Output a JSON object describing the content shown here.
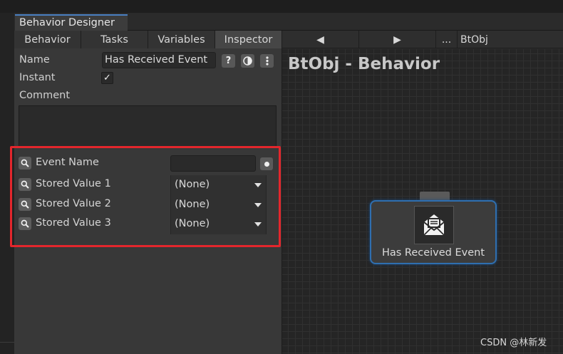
{
  "window": {
    "title": "Behavior Designer"
  },
  "tabs": [
    {
      "label": "Behavior"
    },
    {
      "label": "Tasks"
    },
    {
      "label": "Variables"
    },
    {
      "label": "Inspector"
    }
  ],
  "inspector": {
    "name_label": "Name",
    "name_value": "Has Received Event",
    "help_btn": "?",
    "instant_label": "Instant",
    "instant_check": "✓",
    "comment_label": "Comment",
    "comment_value": ""
  },
  "variables": {
    "event_name_label": "Event Name",
    "event_name_value": "",
    "rows": [
      {
        "label": "Stored Value 1",
        "value": "(None)"
      },
      {
        "label": "Stored Value 2",
        "value": "(None)"
      },
      {
        "label": "Stored Value 3",
        "value": "(None)"
      }
    ]
  },
  "nav": {
    "prev": "◀",
    "next": "▶",
    "ellipsis": "...",
    "object": "BtObj"
  },
  "graph": {
    "title": "BtObj - Behavior",
    "node_label": "Has Received Event",
    "node_icon": "envelope-icon"
  },
  "watermark": "CSDN @林新发",
  "colors": {
    "node_border": "#2f6fb0",
    "highlight": "#e3262c"
  }
}
